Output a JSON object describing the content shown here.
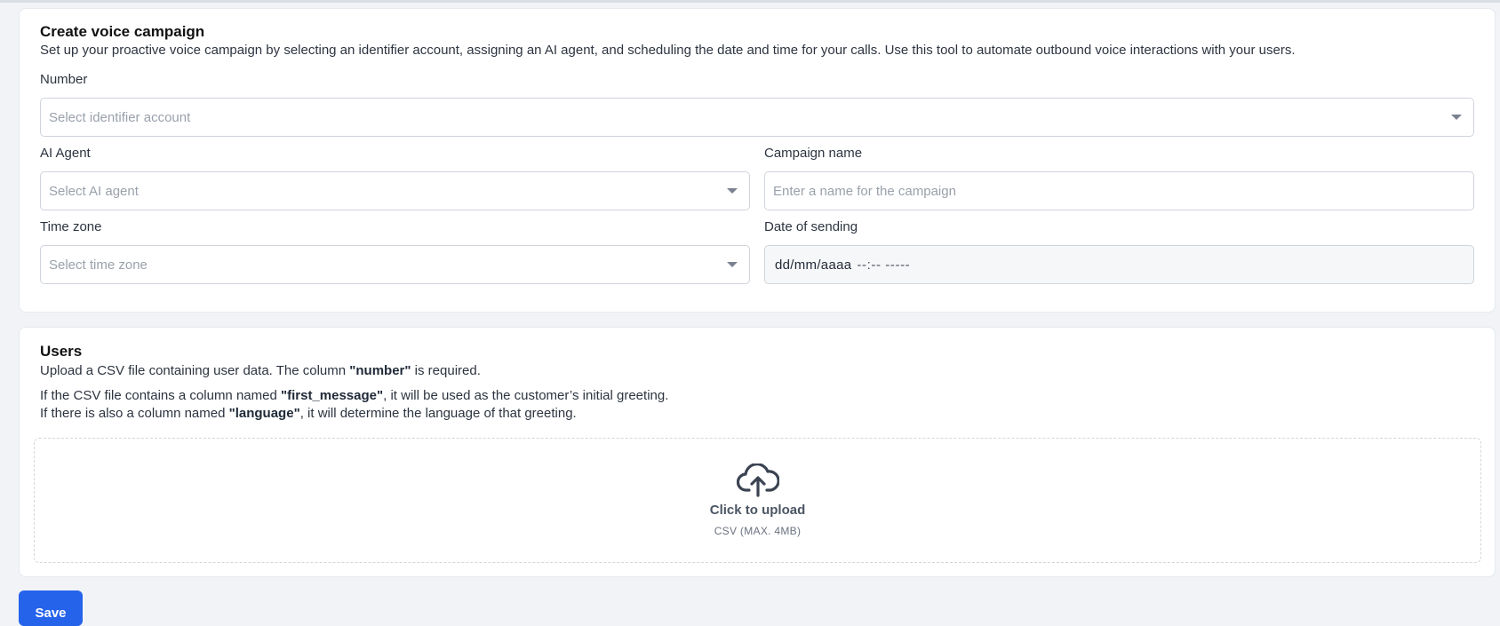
{
  "campaign": {
    "title": "Create voice campaign",
    "description": "Set up your proactive voice campaign by selecting an identifier account, assigning an AI agent, and scheduling the date and time for your calls. Use this tool to automate outbound voice interactions with your users.",
    "number": {
      "label": "Number",
      "placeholder": "Select identifier account"
    },
    "ai_agent": {
      "label": "AI Agent",
      "placeholder": "Select AI agent"
    },
    "campaign_name": {
      "label": "Campaign name",
      "placeholder": "Enter a name for the campaign"
    },
    "time_zone": {
      "label": "Time zone",
      "placeholder": "Select time zone"
    },
    "date_of_sending": {
      "label": "Date of sending",
      "date_mask": "dd/mm/aaaa",
      "time_mask": "--:-- -----"
    }
  },
  "users": {
    "title": "Users",
    "line1_pre": "Upload a CSV file containing user data. The column ",
    "line1_bold": "\"number\"",
    "line1_post": " is required.",
    "line2_pre": "If the CSV file contains a column named ",
    "line2_bold": "\"first_message\"",
    "line2_post": ", it will be used as the customer’s initial greeting.",
    "line3_pre": "If there is also a column named ",
    "line3_bold": "\"language\"",
    "line3_post": ", it will determine the language of that greeting.",
    "upload": {
      "icon": "cloud-upload-icon",
      "main": "Click to upload",
      "sub": "CSV (MAX. 4MB)"
    }
  },
  "save_label": "Save",
  "colors": {
    "primary": "#2563eb",
    "background": "#f1f3f7",
    "card": "#ffffff"
  }
}
